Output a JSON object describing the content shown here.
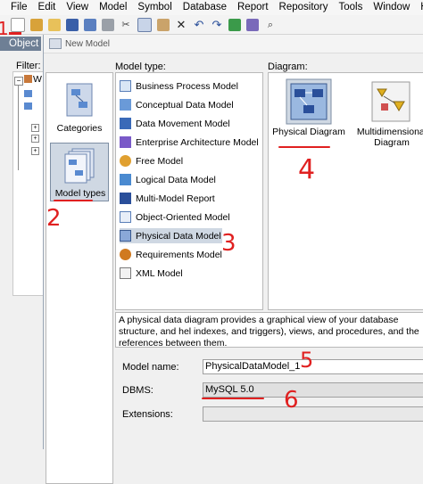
{
  "menu": [
    "File",
    "Edit",
    "View",
    "Model",
    "Symbol",
    "Database",
    "Report",
    "Repository",
    "Tools",
    "Window",
    "Help"
  ],
  "toolbar_icons": [
    "new-icon",
    "new-model-icon",
    "open-icon",
    "save-icon",
    "save-all-icon",
    "print-icon",
    "cut-icon",
    "copy-icon",
    "paste-icon",
    "delete-icon",
    "undo-icon",
    "redo-icon",
    "check-icon",
    "generate-icon",
    "find-icon"
  ],
  "left_panel": {
    "object_tab": "Object",
    "filter_label": "Filter:",
    "tree_root_fragment": "W"
  },
  "dialog": {
    "title": "New Model",
    "model_type_label": "Model type:",
    "diagram_label": "Diagram:",
    "categories": [
      {
        "label": "Categories",
        "selected": false
      },
      {
        "label": "Model types",
        "selected": true
      }
    ],
    "model_types": [
      {
        "label": "Business Process Model",
        "icon": "business-process-icon"
      },
      {
        "label": "Conceptual Data Model",
        "icon": "conceptual-data-icon"
      },
      {
        "label": "Data Movement Model",
        "icon": "data-movement-icon"
      },
      {
        "label": "Enterprise Architecture Model",
        "icon": "enterprise-architecture-icon"
      },
      {
        "label": "Free Model",
        "icon": "free-model-icon"
      },
      {
        "label": "Logical Data Model",
        "icon": "logical-data-icon"
      },
      {
        "label": "Multi-Model Report",
        "icon": "multi-model-report-icon"
      },
      {
        "label": "Object-Oriented Model",
        "icon": "object-oriented-icon"
      },
      {
        "label": "Physical Data Model",
        "icon": "physical-data-icon",
        "selected": true
      },
      {
        "label": "Requirements Model",
        "icon": "requirements-icon"
      },
      {
        "label": "XML Model",
        "icon": "xml-model-icon"
      }
    ],
    "diagrams": [
      {
        "label": "Physical Diagram",
        "selected": true
      },
      {
        "label": "Multidimensional Diagram",
        "selected": false
      }
    ],
    "description": "A physical data diagram provides a graphical view of your database structure, and hel indexes, and triggers), views, and procedures, and the references between them.",
    "model_name_label": "Model name:",
    "model_name_value": "PhysicalDataModel_1",
    "dbms_label": "DBMS:",
    "dbms_value": "MySQL 5.0",
    "extensions_label": "Extensions:",
    "extensions_value": ""
  },
  "annotations": [
    "1",
    "2",
    "3",
    "4",
    "5",
    "6"
  ],
  "colors": {
    "annotation_red": "#e02020",
    "selection_bg": "#cfd8e3",
    "object_tab_bg": "#6e7f95"
  }
}
